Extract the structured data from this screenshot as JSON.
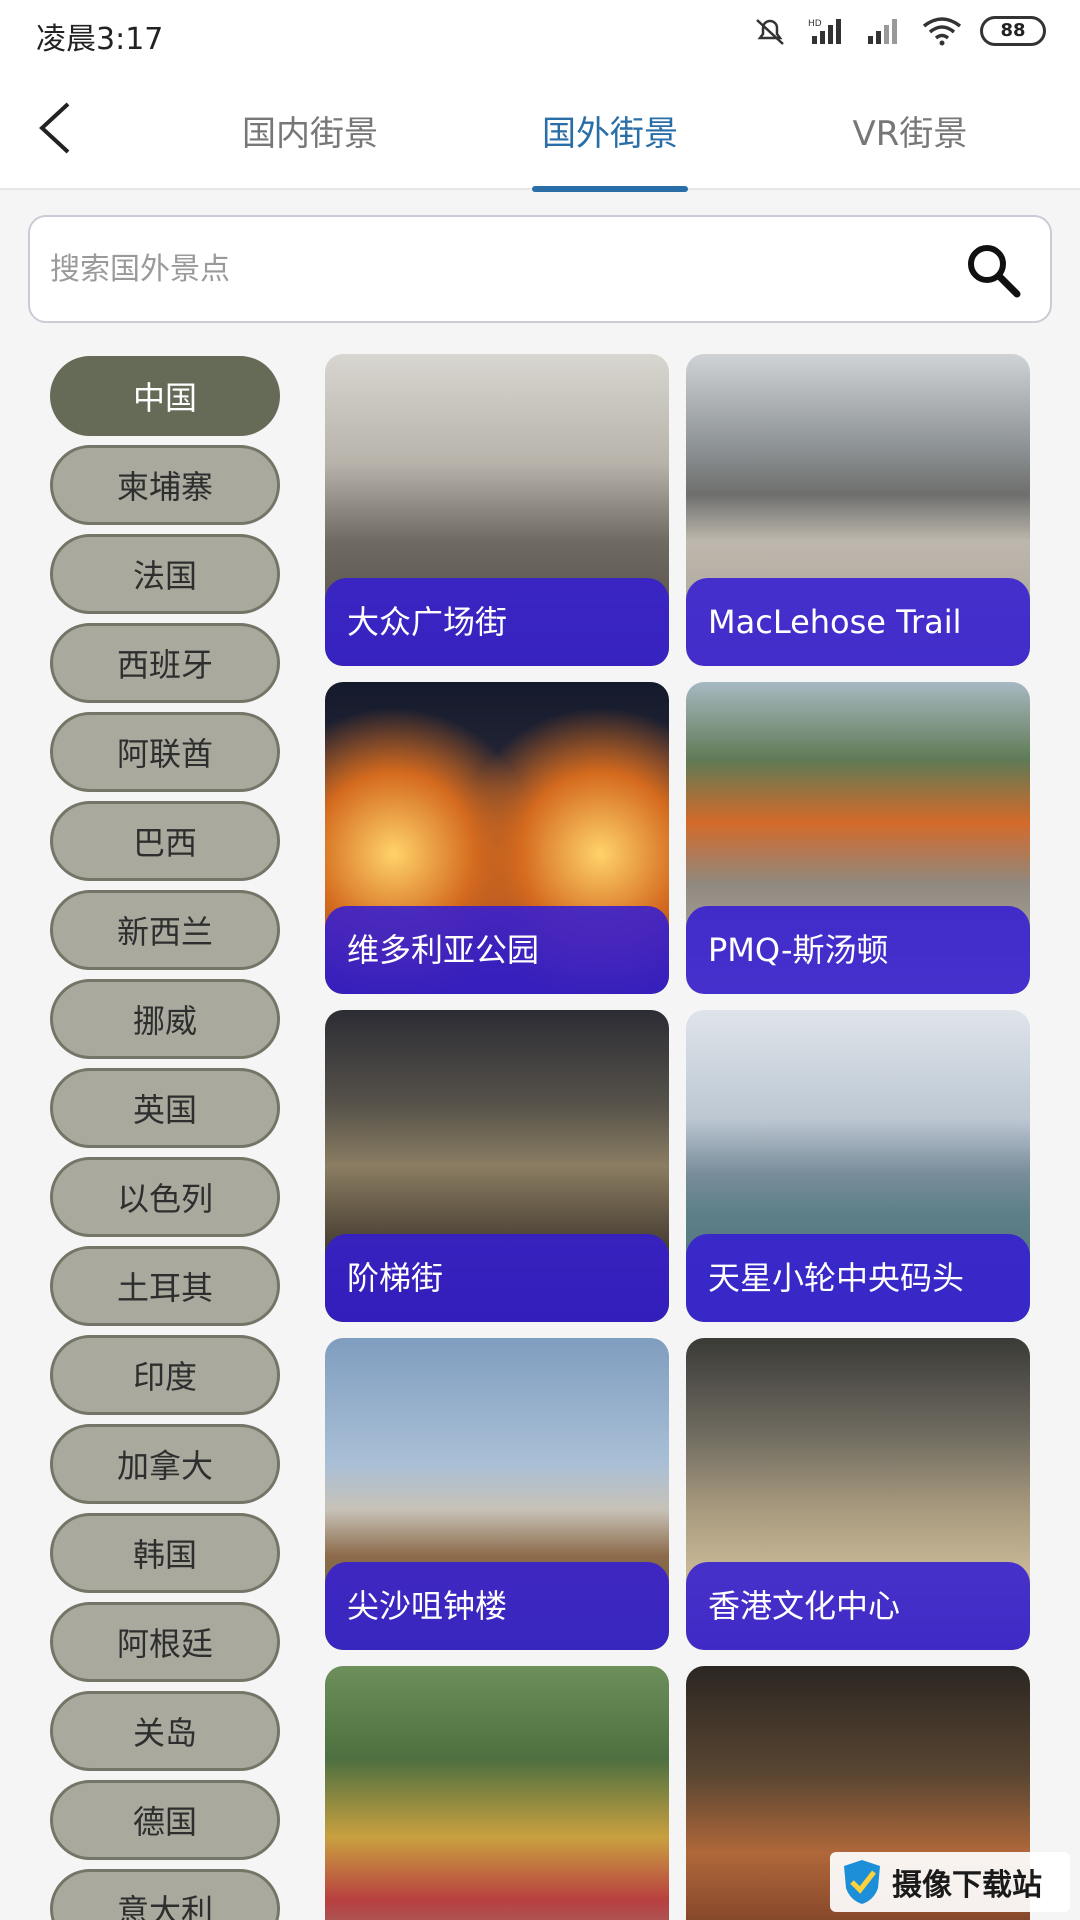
{
  "status": {
    "time": "凌晨3:17",
    "battery": "88"
  },
  "tabs": [
    {
      "label": "国内街景"
    },
    {
      "label": "国外街景"
    },
    {
      "label": "VR街景"
    }
  ],
  "search": {
    "placeholder": "搜索国外景点",
    "value": ""
  },
  "countries": [
    "中国",
    "柬埔寨",
    "法国",
    "西班牙",
    "阿联酋",
    "巴西",
    "新西兰",
    "挪威",
    "英国",
    "以色列",
    "土耳其",
    "印度",
    "加拿大",
    "韩国",
    "阿根廷",
    "关岛",
    "德国",
    "意大利"
  ],
  "places": [
    {
      "name": "大众广场街"
    },
    {
      "name": "MacLehose Trail"
    },
    {
      "name": "维多利亚公园"
    },
    {
      "name": "PMQ-斯汤顿"
    },
    {
      "name": "阶梯街"
    },
    {
      "name": "天星小轮中央码头"
    },
    {
      "name": "尖沙咀钟楼"
    },
    {
      "name": "香港文化中心"
    },
    {
      "name": ""
    },
    {
      "name": ""
    }
  ],
  "watermark": {
    "text": "摄像下载站"
  },
  "colors": {
    "accent": "#2a6ea8",
    "caption": "#341ed2",
    "chip": "#a9a99e",
    "chip_active": "#666b58"
  }
}
